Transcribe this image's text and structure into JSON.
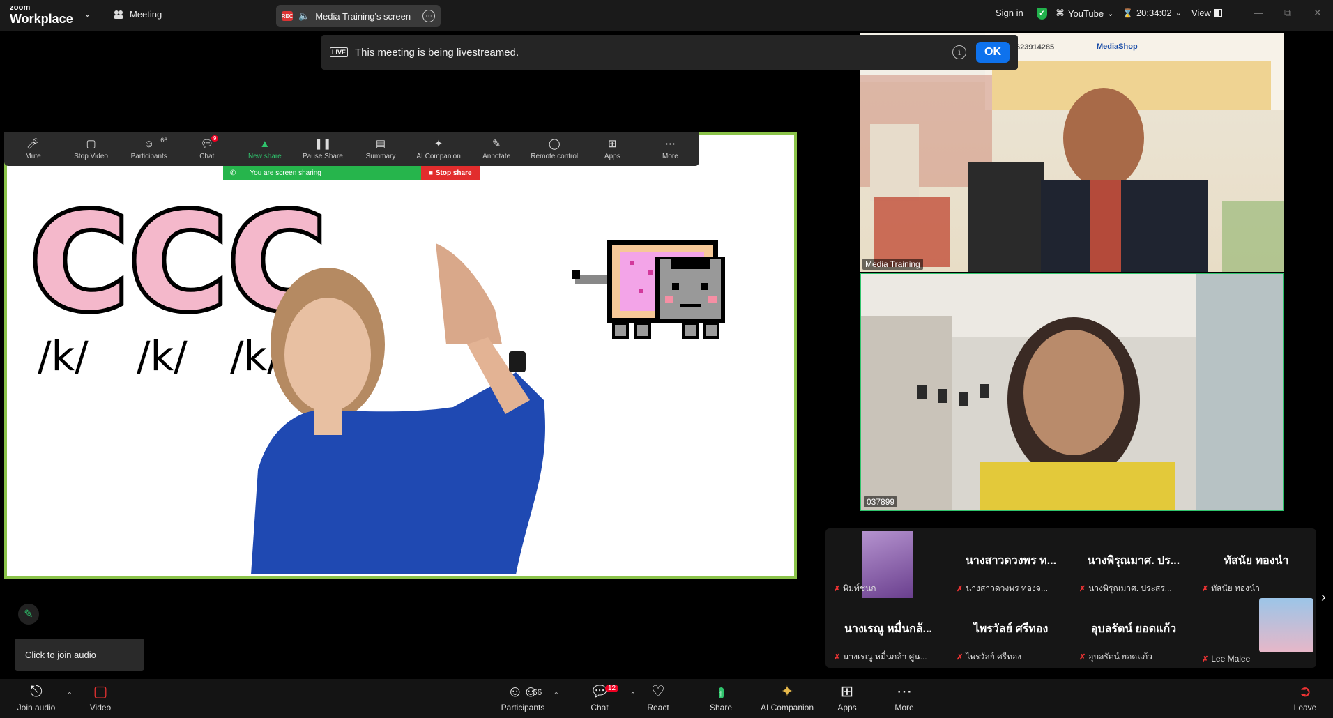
{
  "app": {
    "logo_line1": "zoom",
    "logo_line2": "Workplace"
  },
  "titlebar": {
    "meeting_label": "Meeting",
    "share_tab_label": "Media Training's screen",
    "sign_in": "Sign in",
    "stream_target": "YouTube",
    "timer": "20:34:02",
    "view_label": "View"
  },
  "banner": {
    "live_badge": "LIVE",
    "message": "This meeting is being livestreamed.",
    "ok_label": "OK"
  },
  "share_toolbar": {
    "items": [
      {
        "label": "Mute",
        "icon": "mic-icon"
      },
      {
        "label": "Stop Video",
        "icon": "camera-icon"
      },
      {
        "label": "Participants",
        "icon": "participants-icon",
        "count": "66"
      },
      {
        "label": "Chat",
        "icon": "chat-icon",
        "badge": "9"
      },
      {
        "label": "New share",
        "icon": "share-icon"
      },
      {
        "label": "Pause Share",
        "icon": "pause-icon"
      },
      {
        "label": "Summary",
        "icon": "summary-icon"
      },
      {
        "label": "AI Companion",
        "icon": "sparkle-icon"
      },
      {
        "label": "Annotate",
        "icon": "pen-icon"
      },
      {
        "label": "Remote control",
        "icon": "mouse-icon"
      },
      {
        "label": "Apps",
        "icon": "apps-icon"
      },
      {
        "label": "More",
        "icon": "more-icon"
      }
    ],
    "sharing_status": "You are screen sharing",
    "stop_share": "Stop share"
  },
  "slide": {
    "letters": [
      "C",
      "C",
      "C"
    ],
    "phonemes": [
      "/k/",
      "/k/",
      "/k/"
    ]
  },
  "video_tiles": [
    {
      "name": "Media Training",
      "poster_phone": "623914285",
      "poster_brand": "MediaShop"
    },
    {
      "name": "037899"
    }
  ],
  "gallery": [
    {
      "display": "",
      "label": "พิมพ์ชนก",
      "has_thumbnail": true
    },
    {
      "display": "นางสาวดวงพร ท...",
      "label": "นางสาวดวงพร ทองจ..."
    },
    {
      "display": "นางพิรุณมาศ. ปร...",
      "label": "นางพิรุณมาศ. ประสร..."
    },
    {
      "display": "ทัสนัย ทองนำ",
      "label": "ทัสนัย ทองนำ"
    },
    {
      "display": "นางเรณู หมื่นกล้...",
      "label": "นางเรณู หมื่นกล้า ศูน..."
    },
    {
      "display": "ไพรวัลย์ ศรีทอง",
      "label": "ไพรวัลย์ ศรีทอง"
    },
    {
      "display": "อุบลรัตน์ ยอดแก้ว",
      "label": "อุบลรัตน์ ยอดแก้ว"
    },
    {
      "display": "",
      "label": "Lee Malee",
      "has_thumbnail": true
    }
  ],
  "tooltip": {
    "text": "Click to join audio"
  },
  "bottom_toolbar": {
    "join_audio": "Join audio",
    "video": "Video",
    "participants": "Participants",
    "participants_count": "66",
    "chat": "Chat",
    "chat_badge": "12",
    "react": "React",
    "share": "Share",
    "ai_companion": "AI Companion",
    "apps": "Apps",
    "more": "More",
    "leave": "Leave"
  },
  "colors": {
    "accent_green": "#2fc36c",
    "share_border": "#8bc34a",
    "ok_blue": "#0e72ed",
    "stop_red": "#e22d2d"
  }
}
